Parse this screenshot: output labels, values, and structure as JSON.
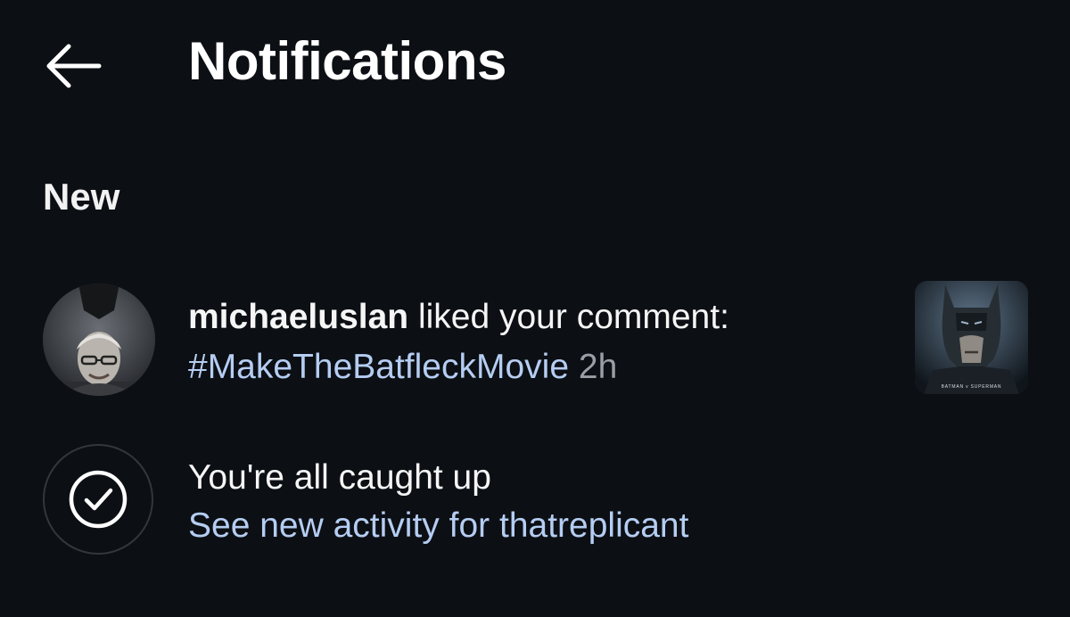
{
  "header": {
    "title": "Notifications",
    "back_icon": "arrow-left-icon"
  },
  "sections": {
    "new_label": "New"
  },
  "notification": {
    "username": "michaeluslan",
    "action_text": " liked your comment:",
    "hashtag": "#MakeTheBatfleckMovie",
    "time": "2h",
    "avatar": "profile-photo",
    "thumbnail": "post-thumbnail",
    "thumbnail_caption": "BATMAN v SUPERMAN"
  },
  "caught_up": {
    "title": "You're all caught up",
    "link": "See new activity for thatreplicant",
    "icon": "checkmark-circle-icon"
  },
  "colors": {
    "background": "#0c0f14",
    "text": "#f5f5f5",
    "link": "#b5cdf2",
    "muted": "#9a9ea6"
  }
}
